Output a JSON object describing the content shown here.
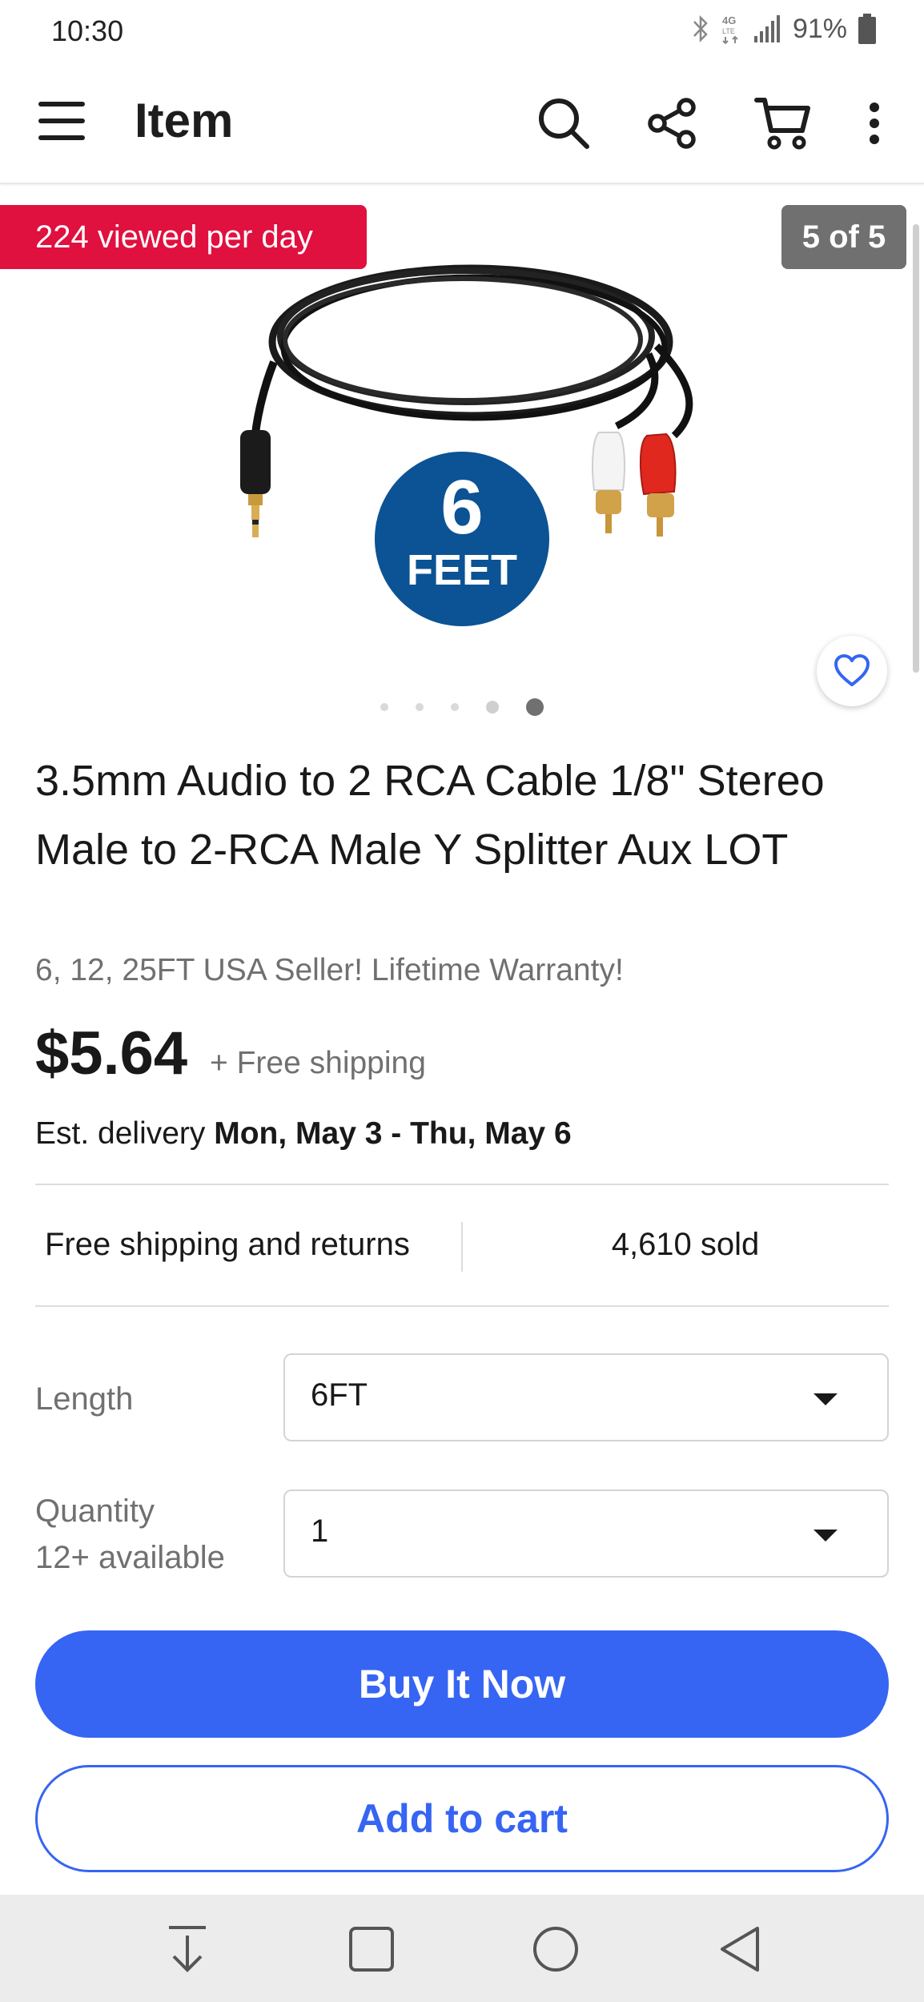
{
  "status_bar": {
    "time": "10:30",
    "network": "4G LTE",
    "battery": "91%",
    "icons": [
      "bluetooth-icon",
      "network-icon",
      "signal-icon",
      "battery-icon"
    ]
  },
  "app_bar": {
    "title": "Item",
    "icons": [
      "menu-icon",
      "search-icon",
      "share-icon",
      "cart-icon",
      "more-icon"
    ]
  },
  "gallery": {
    "viewed_badge": "224 viewed per day",
    "image_count": "5 of 5",
    "feet_number": "6",
    "feet_unit": "FEET",
    "current_index": 5,
    "total_images": 5
  },
  "item": {
    "title": "3.5mm Audio to 2 RCA Cable 1/8\" Stereo Male to 2-RCA Male Y Splitter Aux LOT",
    "subtitle": "6, 12, 25FT USA Seller! Lifetime Warranty!",
    "price": "$5.64",
    "shipping": "+ Free shipping",
    "delivery_prefix": "Est. delivery",
    "delivery_dates": "Mon, May 3 - Thu, May 6"
  },
  "features": {
    "left": "Free shipping and returns",
    "right": "4,610 sold"
  },
  "options": {
    "length_label": "Length",
    "length_value": "6FT",
    "quantity_label": "Quantity",
    "quantity_available": "12+ available",
    "quantity_value": "1"
  },
  "actions": {
    "buy_now": "Buy It Now",
    "add_to_cart": "Add to cart"
  },
  "colors": {
    "accent": "#3665f3",
    "badge_red": "#e0103f",
    "feet_blue": "#0b5394"
  }
}
